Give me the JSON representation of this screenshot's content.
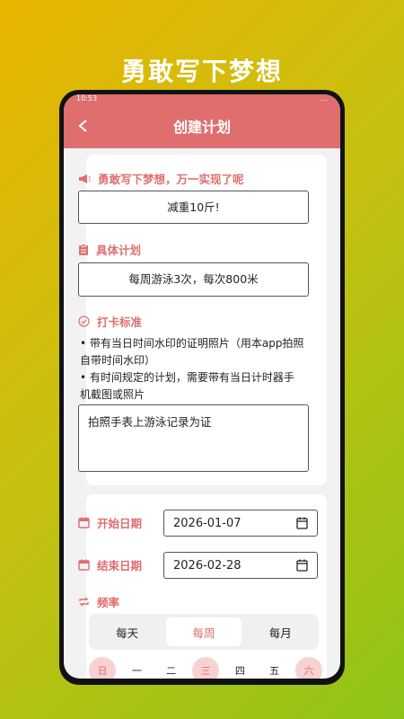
{
  "promo": {
    "title": "勇敢写下梦想"
  },
  "statusbar": {
    "time": "10:53",
    "right": "…"
  },
  "appbar": {
    "title": "创建计划"
  },
  "dream": {
    "label": "勇敢写下梦想，万一实现了呢",
    "value": "减重10斤!"
  },
  "plan": {
    "label": "具体计划",
    "value": "每周游泳3次，每次800米"
  },
  "checkin": {
    "label": "打卡标准",
    "bullet1": "• 带有当日时间水印的证明照片（用本app拍照自带时间水印）",
    "bullet2": "• 有时间规定的计划，需要带有当日计时器手机截图或照片",
    "value": "拍照手表上游泳记录为证"
  },
  "dates": {
    "start_label": "开始日期",
    "start_value": "2026-01-07",
    "end_label": "结束日期",
    "end_value": "2026-02-28"
  },
  "frequency": {
    "label": "频率",
    "options": [
      "每天",
      "每周",
      "每月"
    ],
    "selected": "每周"
  },
  "weekdays": {
    "days": [
      "日",
      "一",
      "二",
      "三",
      "四",
      "五",
      "六"
    ]
  },
  "colors": {
    "accent": "#e06e6e",
    "accent_light": "#f8d2d2"
  }
}
